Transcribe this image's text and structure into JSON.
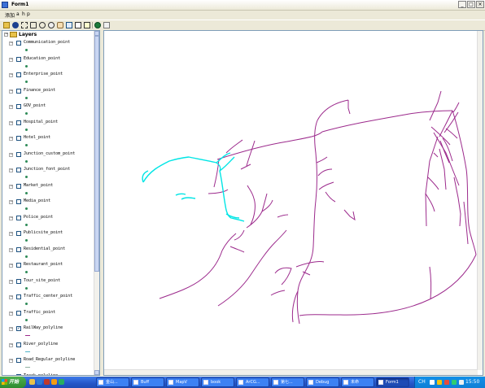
{
  "window": {
    "title": "Form1"
  },
  "menu": {
    "items": [
      "添加",
      "a",
      "h",
      "p"
    ]
  },
  "toolbar": {
    "icons": [
      "open-icon",
      "info-icon",
      "full-extent-icon",
      "fixed-zoom-in-icon",
      "zoom-in-icon",
      "zoom-out-icon",
      "pan-icon",
      "select-icon",
      "identify-icon",
      "map-tips-icon",
      "globe-icon",
      "measure-icon"
    ]
  },
  "toc": {
    "root": {
      "label": "Layers",
      "expanded": true
    },
    "layers": [
      {
        "name": "Communication_point",
        "checked": false,
        "symbol": "point"
      },
      {
        "name": "Education_point",
        "checked": false,
        "symbol": "point"
      },
      {
        "name": "Enterprise_point",
        "checked": false,
        "symbol": "point"
      },
      {
        "name": "Finance_point",
        "checked": false,
        "symbol": "point"
      },
      {
        "name": "GOV_point",
        "checked": false,
        "symbol": "point"
      },
      {
        "name": "Hospital_point",
        "checked": false,
        "symbol": "point"
      },
      {
        "name": "Hotel_point",
        "checked": false,
        "symbol": "point"
      },
      {
        "name": "Junction_custom_point",
        "checked": false,
        "symbol": "point"
      },
      {
        "name": "Junction_font_point",
        "checked": false,
        "symbol": "point"
      },
      {
        "name": "Market_point",
        "checked": false,
        "symbol": "point"
      },
      {
        "name": "Media_point",
        "checked": false,
        "symbol": "point"
      },
      {
        "name": "Police_point",
        "checked": false,
        "symbol": "point"
      },
      {
        "name": "Publicsite_point",
        "checked": false,
        "symbol": "point"
      },
      {
        "name": "Residential_point",
        "checked": false,
        "symbol": "point"
      },
      {
        "name": "Restaurant_point",
        "checked": false,
        "symbol": "point"
      },
      {
        "name": "Tour_site_point",
        "checked": false,
        "symbol": "point"
      },
      {
        "name": "Traffic_center_point",
        "checked": false,
        "symbol": "point"
      },
      {
        "name": "Traffic_point",
        "checked": false,
        "symbol": "point"
      },
      {
        "name": "RailWay_polyline",
        "checked": true,
        "symbol": "line",
        "color": "#9c2a8c"
      },
      {
        "name": "River_polyline",
        "checked": false,
        "symbol": "line",
        "color": "#4fb3c8"
      },
      {
        "name": "Road_Regular_polyline",
        "checked": false,
        "symbol": "line",
        "color": "#8fb0a0"
      },
      {
        "name": "Track_polyline",
        "checked": false,
        "symbol": "line",
        "color": "#a0a0a0"
      }
    ]
  },
  "map": {
    "railway_color": "#9c2a8c",
    "highlight_color": "#00e5e5"
  },
  "taskbar": {
    "start_label": "开始",
    "tasks": [
      {
        "label": "金山...",
        "active": false
      },
      {
        "label": "Buff",
        "active": false
      },
      {
        "label": "MapV",
        "active": false
      },
      {
        "label": "book",
        "active": false
      },
      {
        "label": "ArCG...",
        "active": false
      },
      {
        "label": "第七...",
        "active": false
      },
      {
        "label": "Debug",
        "active": false
      },
      {
        "label": "未命",
        "active": false
      },
      {
        "label": "Form1",
        "active": true
      }
    ],
    "tray": {
      "lang": "CH",
      "time": "15:50"
    }
  }
}
